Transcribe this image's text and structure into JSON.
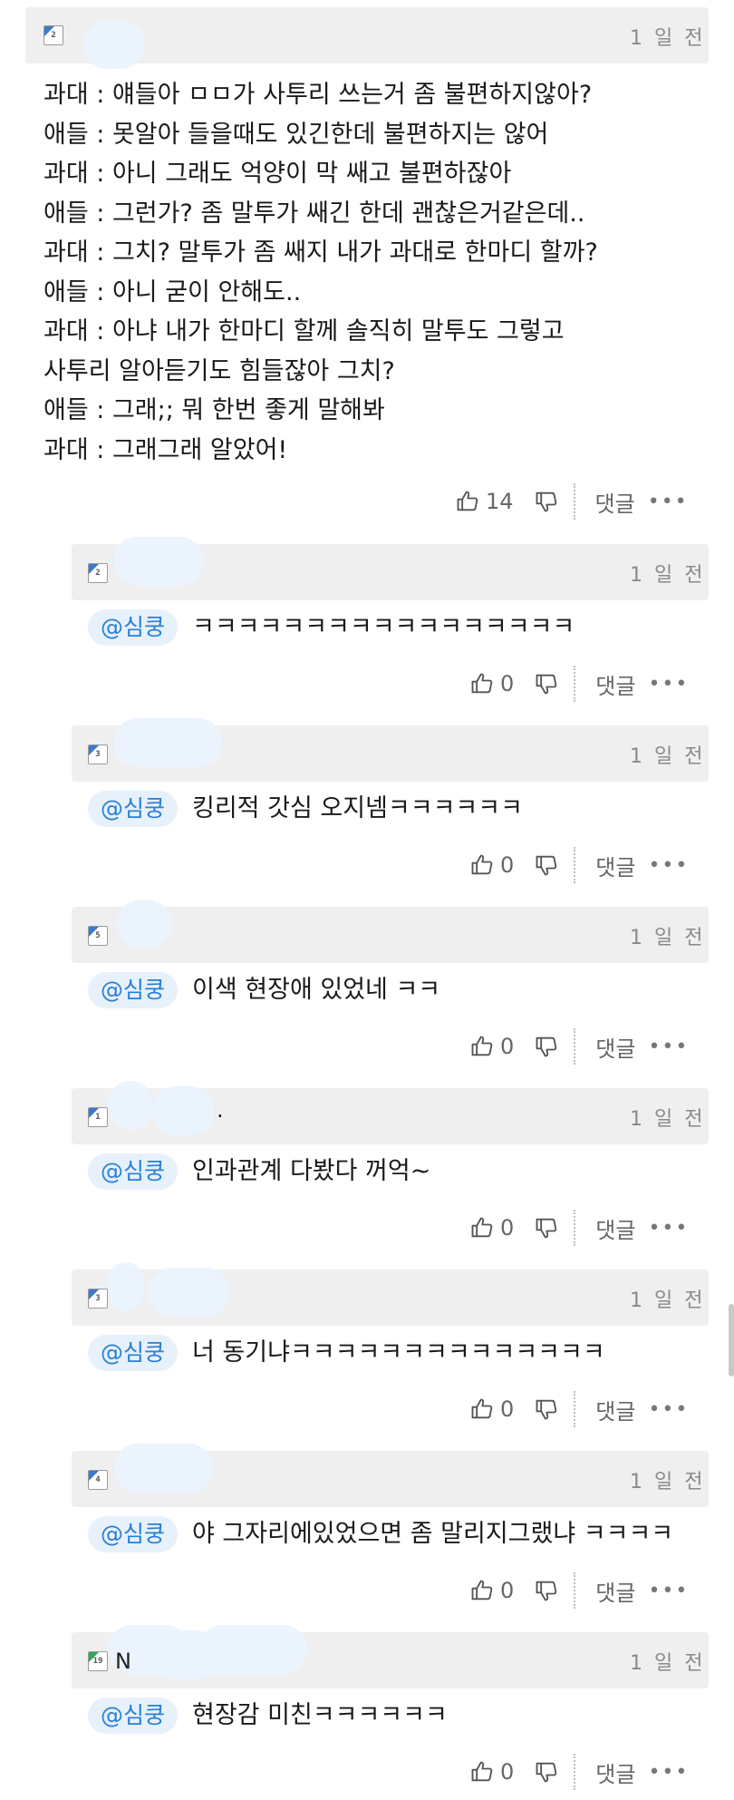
{
  "main_comment": {
    "level": "2",
    "time": "1 일 전",
    "lines": [
      "과대 : 얘들아 ㅁㅁ가 사투리 쓰는거 좀 불편하지않아?",
      "애들 : 못알아 들을때도 있긴한데 불편하지는 않어",
      "과대 : 아니 그래도 억양이 막 쌔고 불편하잖아",
      "애들 : 그런가? 좀 말투가 쌔긴 한데 괜찮은거같은데..",
      "과대 : 그치? 말투가 좀 쌔지 내가 과대로 한마디 할까?",
      "애들 : 아니 굳이 안해도..",
      "과대 : 아냐 내가 한마디 할께 솔직히 말투도 그렇고",
      "사투리 알아듣기도 힘들잖아 그치?",
      "애들 : 그래;; 뭐 한번 좋게 말해봐",
      "과대 : 그래그래 알았어!"
    ],
    "likes": "14"
  },
  "labels": {
    "reply": "댓글",
    "more": "•••"
  },
  "replies": [
    {
      "level": "2",
      "time": "1 일 전",
      "mention": "@심쿵",
      "text": "ㅋㅋㅋㅋㅋㅋㅋㅋㅋㅋㅋㅋㅋㅋㅋㅋㅋ",
      "likes": "0",
      "nick_trail": ""
    },
    {
      "level": "3",
      "time": "1 일 전",
      "mention": "@심쿵",
      "text": "킹리적 갓심 오지넴ㅋㅋㅋㅋㅋㅋ",
      "likes": "0",
      "nick_trail": ""
    },
    {
      "level": "5",
      "time": "1 일 전",
      "mention": "@심쿵",
      "text": "이색 현장애 있었네 ㅋㅋ",
      "likes": "0",
      "nick_trail": ""
    },
    {
      "level": "1",
      "time": "1 일 전",
      "mention": "@심쿵",
      "text": "인과관계 다봤다 꺼억~",
      "likes": "0",
      "nick_trail": "."
    },
    {
      "level": "3",
      "time": "1 일 전",
      "mention": "@심쿵",
      "text": "너 동기냐ㅋㅋㅋㅋㅋㅋㅋㅋㅋㅋㅋㅋㅋㅋ",
      "likes": "0",
      "nick_trail": ""
    },
    {
      "level": "4",
      "time": "1 일 전",
      "mention": "@심쿵",
      "text": "야 그자리에있었으면 좀 말리지그랬냐 ㅋㅋㅋㅋ",
      "likes": "0",
      "nick_trail": ""
    },
    {
      "level": "19",
      "time": "1 일 전",
      "mention": "@심쿵",
      "text": "현장감 미친ㅋㅋㅋㅋㅋㅋ",
      "likes": "0",
      "nick_trail": "N"
    }
  ]
}
